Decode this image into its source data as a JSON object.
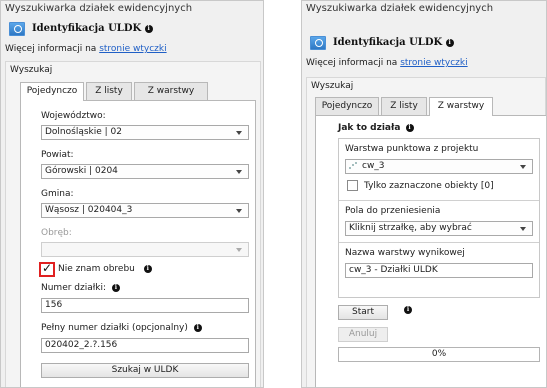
{
  "left": {
    "window_title": "Wyszukiwarka działek ewidencyjnych",
    "plugin_title": "Identyfikacja ULDK",
    "more_info_prefix": "Więcej informacji na ",
    "more_info_link": "stronie wtyczki",
    "group_label": "Wyszukaj",
    "tabs": [
      {
        "label": "Pojedynczo",
        "active": true
      },
      {
        "label": "Z listy",
        "active": false
      },
      {
        "label": "Z warstwy",
        "active": false
      }
    ],
    "fields": {
      "wojewodztwo_label": "Województwo:",
      "wojewodztwo_value": "Dolnośląskie | 02",
      "powiat_label": "Powiat:",
      "powiat_value": "Górowski | 0204",
      "gmina_label": "Gmina:",
      "gmina_value": "Wąsosz | 020404_3",
      "obreb_label": "Obręb:",
      "obreb_value": "",
      "unknown_obreb_label": "Nie znam obrebu",
      "unknown_obreb_checked": true,
      "numer_label": "Numer działki:",
      "numer_value": "156",
      "pelny_label": "Pełny numer działki (opcjonalny)",
      "pelny_value": "020402_2.?.156"
    },
    "search_button": "Szukaj w ULDK"
  },
  "right": {
    "window_title": "Wyszukiwarka działek ewidencyjnych",
    "plugin_title": "Identyfikacja ULDK",
    "more_info_prefix": "Więcej informacji na ",
    "more_info_link": "stronie wtyczki",
    "group_label": "Wyszukaj",
    "tabs": [
      {
        "label": "Pojedynczo",
        "active": false
      },
      {
        "label": "Z listy",
        "active": false
      },
      {
        "label": "Z warstwy",
        "active": true
      }
    ],
    "section_title": "Jak to działa",
    "layer_label": "Warstwa punktowa z projektu",
    "layer_value": "cw_3",
    "selected_only_label": "Tylko zaznaczone obiekty [0]",
    "selected_only_checked": false,
    "fields_label": "Pola do przeniesienia",
    "fields_value": "Kliknij strzałkę, aby wybrać",
    "output_label": "Nazwa warstwy wynikowej",
    "output_value": "cw_3 - Działki ULDK",
    "start_button": "Start",
    "cancel_button": "Anuluj",
    "progress_text": "0%",
    "progress_value": 0
  },
  "icons": [
    "plugin-icon",
    "info-icon",
    "dropdown-arrow-icon",
    "checkmark-icon",
    "point-layer-icon"
  ],
  "colors": {
    "link": "#1f5fc6",
    "highlight": "#e02020",
    "icon_blue": "#2e78c4"
  }
}
